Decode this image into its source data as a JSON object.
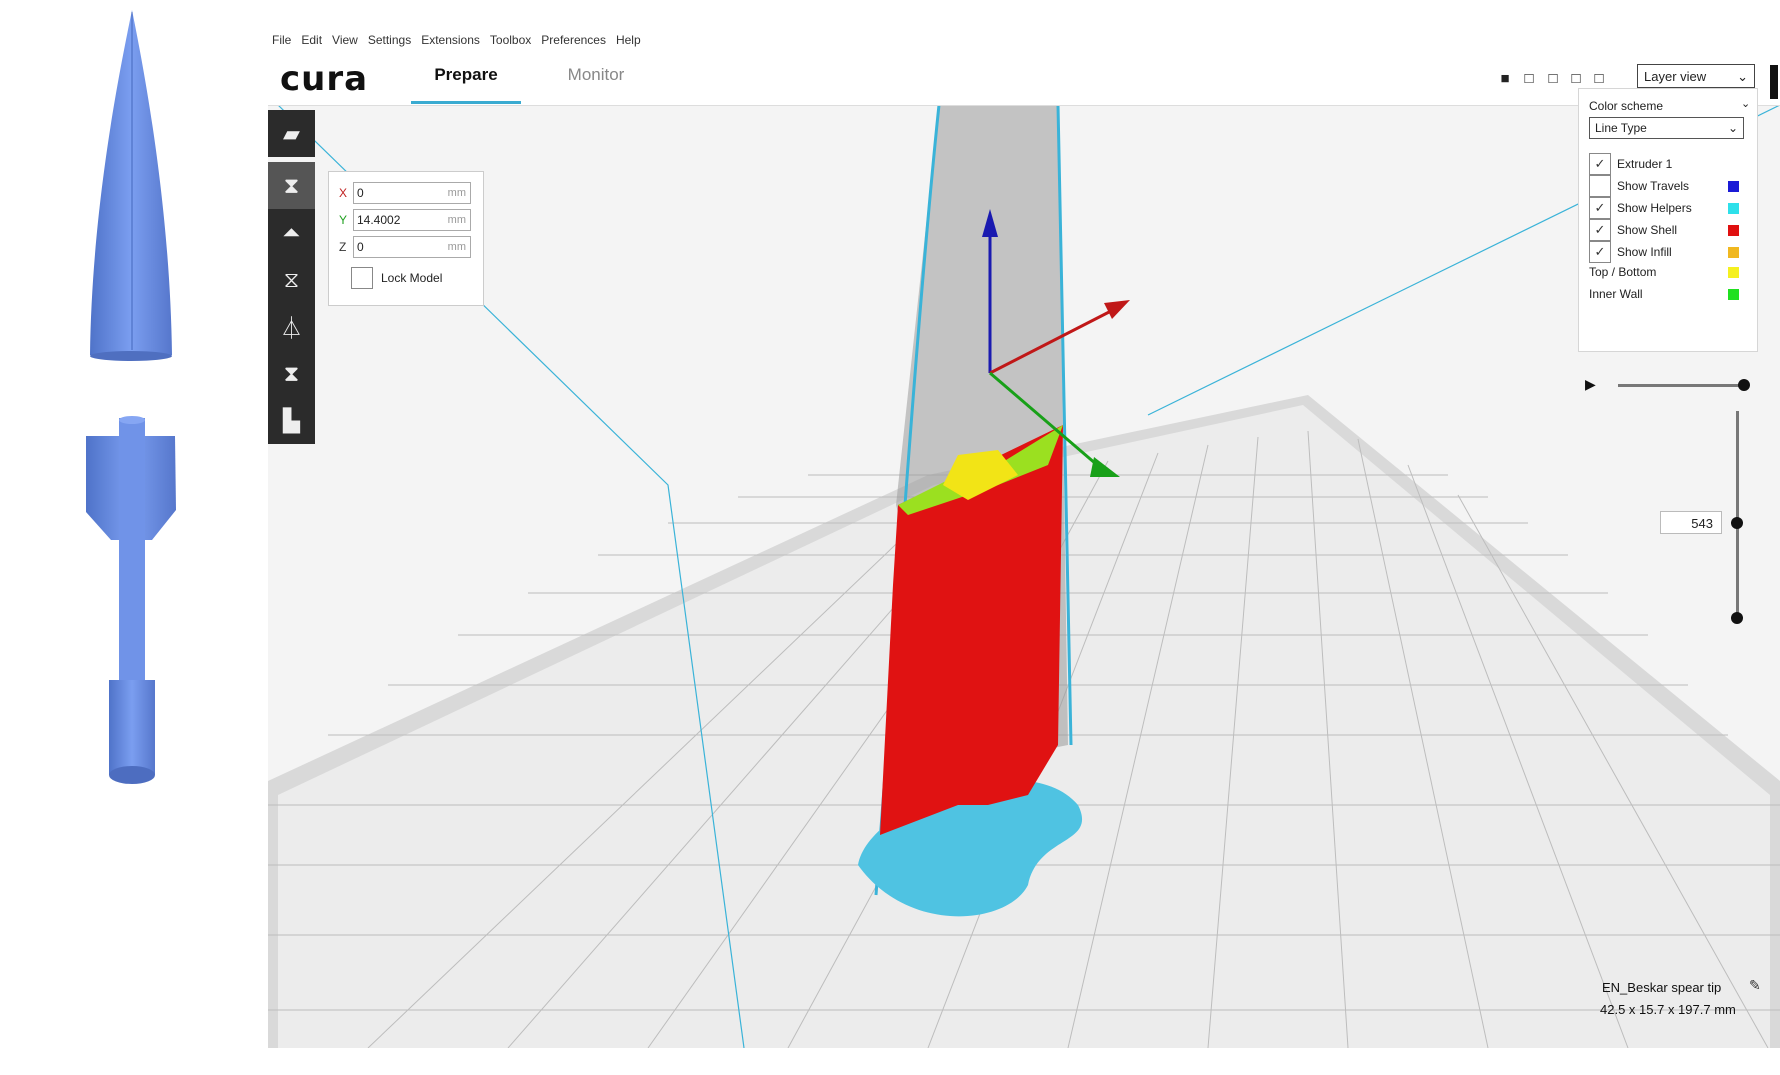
{
  "menu": [
    "File",
    "Edit",
    "View",
    "Settings",
    "Extensions",
    "Toolbox",
    "Preferences",
    "Help"
  ],
  "app": {
    "logo": "cura"
  },
  "tabs": [
    {
      "label": "Prepare"
    },
    {
      "label": "Monitor"
    }
  ],
  "view_mode": {
    "selected": "Layer view"
  },
  "toolbar": {
    "icons": [
      "open-file-icon",
      "move-tool-icon",
      "scale-tool-icon",
      "rotate-tool-icon",
      "mirror-tool-icon",
      "per-model-settings-icon",
      "support-blocker-icon"
    ]
  },
  "move_panel": {
    "x": {
      "label": "X",
      "value": "0",
      "unit": "mm"
    },
    "y": {
      "label": "Y",
      "value": "14.4002",
      "unit": "mm"
    },
    "z": {
      "label": "Z",
      "value": "0",
      "unit": "mm"
    },
    "lock_label": "Lock Model",
    "lock_checked": false
  },
  "layer_panel": {
    "color_scheme_label": "Color scheme",
    "color_scheme_value": "Line Type",
    "items": [
      {
        "label": "Extruder 1",
        "checked": true,
        "swatch": ""
      },
      {
        "label": "Show Travels",
        "checked": false,
        "swatch": "#1a1ad6"
      },
      {
        "label": "Show Helpers",
        "checked": true,
        "swatch": "#2ee0ea"
      },
      {
        "label": "Show Shell",
        "checked": true,
        "swatch": "#e01010"
      },
      {
        "label": "Show Infill",
        "checked": true,
        "swatch": "#f0b820"
      },
      {
        "label": "Top / Bottom",
        "checked": null,
        "swatch": "#f5f020"
      },
      {
        "label": "Inner Wall",
        "checked": null,
        "swatch": "#20e020"
      }
    ],
    "check_mark": "✓",
    "current_layer": "543"
  },
  "object_info": {
    "name": "EN_Beskar spear tip",
    "dimensions": "42.5 x 15.7 x 197.7 mm"
  },
  "colors": {
    "accent": "#3aabd1",
    "model_preview": "#6b8fe3",
    "shell": "#e01010",
    "helpers": "#2ee0ea"
  }
}
